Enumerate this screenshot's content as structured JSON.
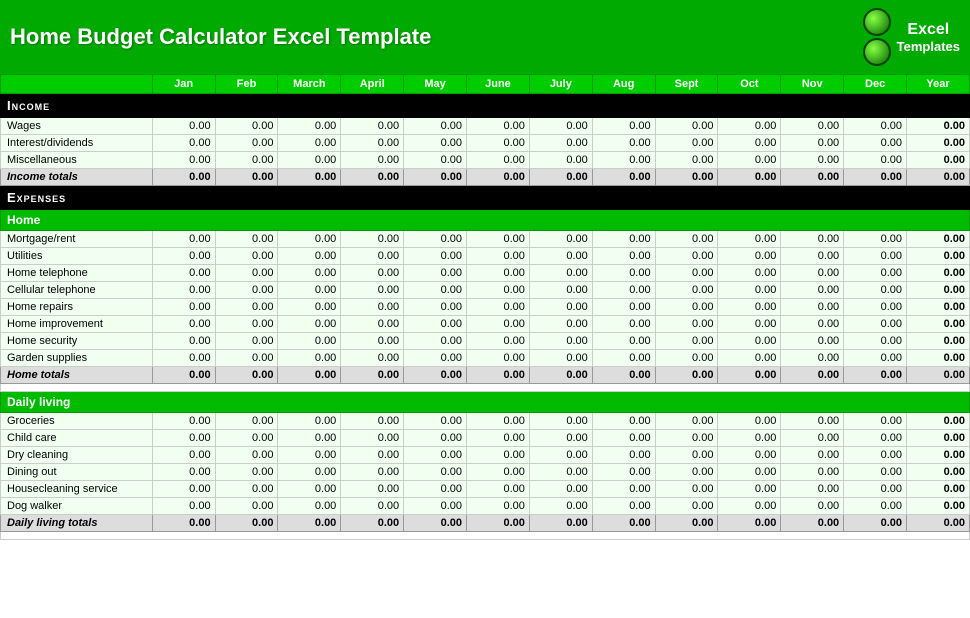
{
  "header": {
    "title": "Home Budget Calculator Excel Template",
    "logo_line1": "Excel",
    "logo_line2": "Templates"
  },
  "columns": {
    "label": "",
    "months": [
      "Jan",
      "Feb",
      "March",
      "April",
      "May",
      "June",
      "July",
      "Aug",
      "Sept",
      "Oct",
      "Nov",
      "Dec"
    ],
    "year": "Year"
  },
  "sections": {
    "income": {
      "title": "Income",
      "rows": [
        {
          "label": "Wages"
        },
        {
          "label": "Interest/dividends"
        },
        {
          "label": "Miscellaneous"
        }
      ],
      "totals_label": "Income totals"
    },
    "expenses": {
      "title": "Expenses"
    },
    "home": {
      "subtitle": "Home",
      "rows": [
        {
          "label": "Mortgage/rent"
        },
        {
          "label": "Utilities"
        },
        {
          "label": "Home telephone"
        },
        {
          "label": "Cellular telephone"
        },
        {
          "label": "Home repairs"
        },
        {
          "label": "Home improvement"
        },
        {
          "label": "Home security"
        },
        {
          "label": "Garden supplies"
        }
      ],
      "totals_label": "Home totals"
    },
    "daily_living": {
      "subtitle": "Daily living",
      "rows": [
        {
          "label": "Groceries"
        },
        {
          "label": "Child care"
        },
        {
          "label": "Dry cleaning"
        },
        {
          "label": "Dining out"
        },
        {
          "label": "Housecleaning service"
        },
        {
          "label": "Dog walker"
        }
      ],
      "totals_label": "Daily living totals"
    }
  },
  "zero_value": "0.00",
  "bold_zero": "0.00"
}
